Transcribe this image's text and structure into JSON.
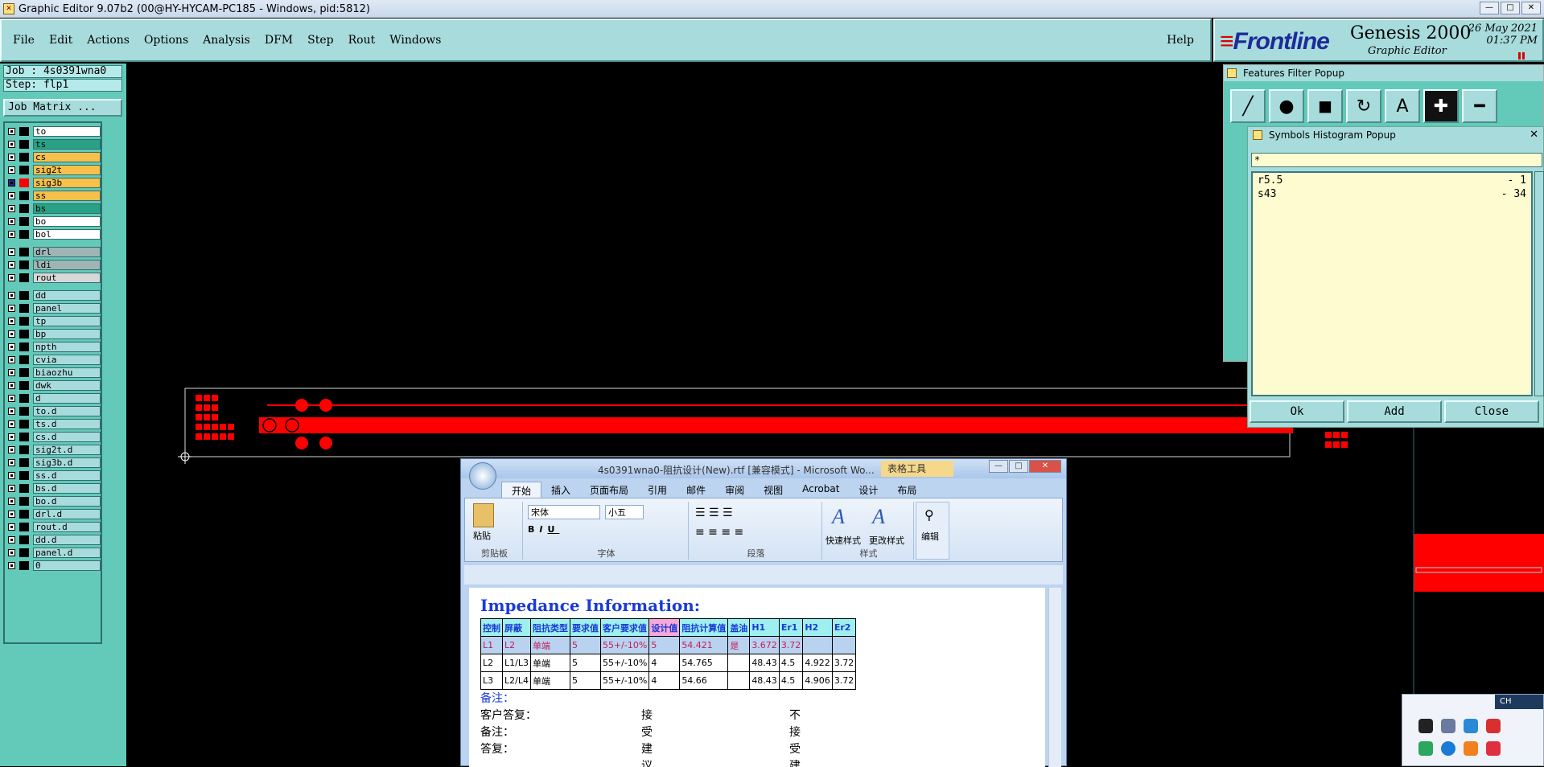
{
  "titlebar": {
    "title": "Graphic Editor 9.07b2 (00@HY-HYCAM-PC185 - Windows, pid:5812)"
  },
  "menu": {
    "items": [
      "File",
      "Edit",
      "Actions",
      "Options",
      "Analysis",
      "DFM",
      "Step",
      "Rout",
      "Windows"
    ],
    "help": "Help"
  },
  "brand": {
    "logo": "Frontline",
    "product": "Genesis 2000",
    "subtitle": "Graphic Editor",
    "date": "26 May 2021",
    "time": "01:37 PM"
  },
  "job": {
    "job": "Job : 4s0391wna0",
    "step": "Step: flp1",
    "matrix_button": "Job Matrix ..."
  },
  "layers": [
    {
      "name": "to",
      "color": "#ffffff"
    },
    {
      "name": "ts",
      "color": "#2aa184"
    },
    {
      "name": "cs",
      "color": "#f7c04a"
    },
    {
      "name": "sig2t",
      "color": "#f7c04a"
    },
    {
      "name": "sig3b",
      "color": "#f7c04a",
      "active": true
    },
    {
      "name": "ss",
      "color": "#f7c04a"
    },
    {
      "name": "bs",
      "color": "#2aa184"
    },
    {
      "name": "bo",
      "color": "#ffffff"
    },
    {
      "name": "bol",
      "color": "#ffffff"
    },
    {
      "name": "drl",
      "color": "#9fb5b5"
    },
    {
      "name": "ldi",
      "color": "#9fb5b5"
    },
    {
      "name": "rout",
      "color": "#d8d8d8"
    },
    {
      "name": "dd",
      "color": "#a8dcdc"
    },
    {
      "name": "panel",
      "color": "#a8dcdc"
    },
    {
      "name": "tp",
      "color": "#a8dcdc"
    },
    {
      "name": "bp",
      "color": "#a8dcdc"
    },
    {
      "name": "npth",
      "color": "#a8dcdc"
    },
    {
      "name": "cvia",
      "color": "#a8dcdc"
    },
    {
      "name": "biaozhu",
      "color": "#a8dcdc"
    },
    {
      "name": "dwk",
      "color": "#a8dcdc"
    },
    {
      "name": "d",
      "color": "#a8dcdc"
    },
    {
      "name": "to.d",
      "color": "#a8dcdc"
    },
    {
      "name": "ts.d",
      "color": "#a8dcdc"
    },
    {
      "name": "cs.d",
      "color": "#a8dcdc"
    },
    {
      "name": "sig2t.d",
      "color": "#a8dcdc"
    },
    {
      "name": "sig3b.d",
      "color": "#a8dcdc"
    },
    {
      "name": "ss.d",
      "color": "#a8dcdc"
    },
    {
      "name": "bs.d",
      "color": "#a8dcdc"
    },
    {
      "name": "bo.d",
      "color": "#a8dcdc"
    },
    {
      "name": "drl.d",
      "color": "#a8dcdc"
    },
    {
      "name": "rout.d",
      "color": "#a8dcdc"
    },
    {
      "name": "dd.d",
      "color": "#a8dcdc"
    },
    {
      "name": "panel.d",
      "color": "#a8dcdc"
    },
    {
      "name": "0",
      "color": "#a8dcdc"
    }
  ],
  "features_filter": {
    "title": "Features Filter Popup",
    "tools": [
      "line-icon",
      "pad-icon",
      "surface-icon",
      "arc-icon",
      "text-icon",
      "plus-icon",
      "minus-icon"
    ]
  },
  "symbols_histogram": {
    "title": "Symbols Histogram Popup",
    "filter": "*",
    "rows": [
      {
        "symbol": "r5.5",
        "count": "- 1"
      },
      {
        "symbol": "s43",
        "count": "- 34"
      }
    ],
    "buttons": {
      "ok": "Ok",
      "add": "Add",
      "close": "Close"
    }
  },
  "word": {
    "title": "4s0391wna0-阻抗设计(New).rtf [兼容模式] - Microsoft Wo...",
    "tool_tab": "表格工具",
    "tabs": [
      "开始",
      "插入",
      "页面布局",
      "引用",
      "邮件",
      "审阅",
      "视图",
      "Acrobat",
      "设计",
      "布局"
    ],
    "ribbon": {
      "clipboard": "剪贴板",
      "paste": "粘贴",
      "font_group": "字体",
      "font_name": "宋体",
      "font_size": "小五",
      "paragraph": "段落",
      "styles": "样式",
      "quick_styles": "快速样式",
      "change_styles": "更改样式",
      "editing": "编辑"
    },
    "heading": "Impedance Information:",
    "table": {
      "header": [
        "控制",
        "屏蔽",
        "阻抗类型",
        "要求值",
        "客户要求值",
        "设计值",
        "阻抗计算值",
        "盖油",
        "H1",
        "Er1",
        "H2",
        "Er2"
      ],
      "rows": [
        [
          "L1",
          "L2",
          "单端",
          "5",
          "55+/-10%",
          "5",
          "54.421",
          "是",
          "3.672",
          "3.72",
          "",
          ""
        ],
        [
          "L2",
          "L1/L3",
          "单端",
          "5",
          "55+/-10%",
          "4",
          "54.765",
          "",
          "48.43",
          "4.5",
          "4.922",
          "3.72"
        ],
        [
          "L3",
          "L2/L4",
          "单端",
          "5",
          "55+/-10%",
          "4",
          "54.66",
          "",
          "48.43",
          "4.5",
          "4.906",
          "3.72"
        ]
      ]
    },
    "notes": [
      {
        "label": "备注：",
        "text": ""
      },
      {
        "label": "客户答复：",
        "a": "接受建议",
        "b": "不接受建议"
      },
      {
        "label": "备注：",
        "text": ""
      },
      {
        "label": "答复：",
        "text": ""
      }
    ]
  },
  "tray": {
    "lang": "CH"
  },
  "colors": {
    "panel": "#63c9b8",
    "menu": "#a8dcdc",
    "feature": "#ff0000"
  }
}
